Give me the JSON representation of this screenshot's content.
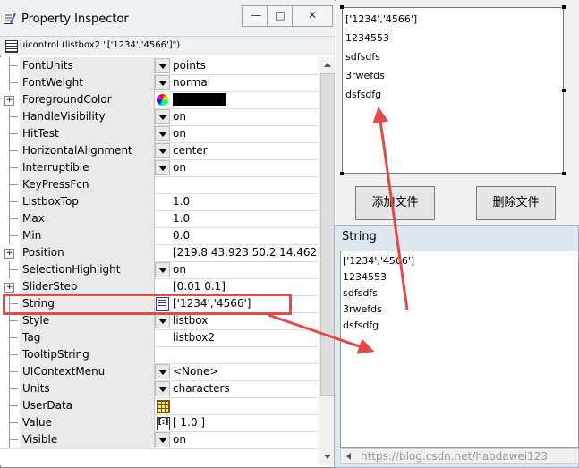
{
  "inspector": {
    "title": "Property Inspector",
    "subtitle": "uicontrol (listbox2 \"['1234','4566']\")",
    "controls": {
      "minimize": "—",
      "restore": "□",
      "close": "✕"
    },
    "rows": [
      {
        "name": "FontUnits",
        "value": "points",
        "control": "dropdown"
      },
      {
        "name": "FontWeight",
        "value": "normal",
        "control": "dropdown"
      },
      {
        "name": "ForegroundColor",
        "value": "",
        "control": "color",
        "expand": true
      },
      {
        "name": "HandleVisibility",
        "value": "on",
        "control": "dropdown"
      },
      {
        "name": "HitTest",
        "value": "on",
        "control": "dropdown"
      },
      {
        "name": "HorizontalAlignment",
        "value": "center",
        "control": "dropdown"
      },
      {
        "name": "Interruptible",
        "value": "on",
        "control": "dropdown"
      },
      {
        "name": "KeyPressFcn",
        "value": "",
        "control": "none"
      },
      {
        "name": "ListboxTop",
        "value": "1.0",
        "control": "none"
      },
      {
        "name": "Max",
        "value": "1.0",
        "control": "none"
      },
      {
        "name": "Min",
        "value": "0.0",
        "control": "none"
      },
      {
        "name": "Position",
        "value": "[219.8 43.923 50.2 14.462]",
        "control": "none",
        "expand": true
      },
      {
        "name": "SelectionHighlight",
        "value": "on",
        "control": "dropdown"
      },
      {
        "name": "SliderStep",
        "value": "[0.01 0.1]",
        "control": "none",
        "expand": true
      },
      {
        "name": "String",
        "value": "['1234','4566']",
        "control": "string"
      },
      {
        "name": "Style",
        "value": "listbox",
        "control": "dropdown"
      },
      {
        "name": "Tag",
        "value": "listbox2",
        "control": "none"
      },
      {
        "name": "TooltipString",
        "value": "",
        "control": "none"
      },
      {
        "name": "UIContextMenu",
        "value": "<None>",
        "control": "dropdown"
      },
      {
        "name": "Units",
        "value": "characters",
        "control": "dropdown"
      },
      {
        "name": "UserData",
        "value": "",
        "control": "grid"
      },
      {
        "name": "Value",
        "value": "[ 1.0 ]",
        "control": "array"
      },
      {
        "name": "Visible",
        "value": "on",
        "control": "dropdown"
      }
    ]
  },
  "listbox": {
    "items": [
      "['1234','4566']",
      "1234553",
      "sdfsdfs",
      "3rwefds",
      "dsfsdfg"
    ],
    "add_button": "添加文件",
    "delete_button": "删除文件"
  },
  "string_dialog": {
    "title": "String",
    "items": [
      "['1234','4566']",
      "1234553",
      "sdfsdfs",
      "3rwefds",
      "dsfsdfg"
    ],
    "watermark": "https://blog.csdn.net/haodawei123"
  },
  "colors": {
    "highlight": "#e24a4a",
    "foreground_color": "#000000"
  }
}
